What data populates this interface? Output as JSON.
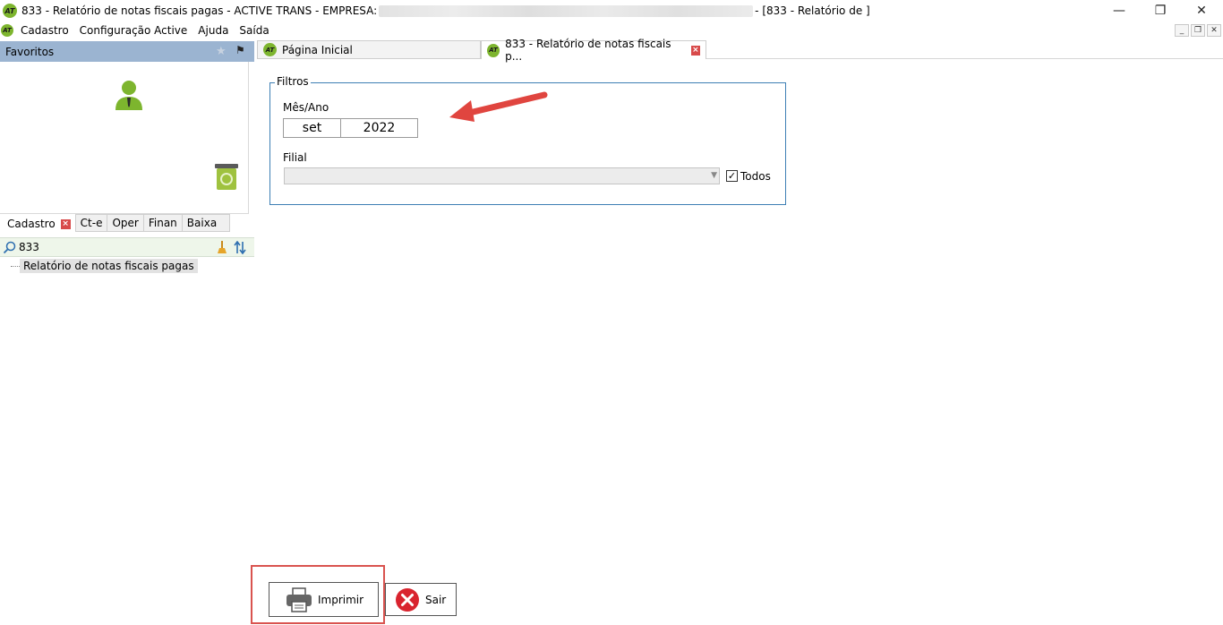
{
  "window": {
    "app_logo": "AT",
    "title_prefix": "833 - Relatório de notas fiscais pagas - ACTIVE TRANS - EMPRESA:",
    "title_suffix": "- [833 - Relatório de ]"
  },
  "menu": [
    "Cadastro",
    "Configuração Active",
    "Ajuda",
    "Saída"
  ],
  "favorites": {
    "title": "Favoritos"
  },
  "left_tabs": [
    "Cadastro",
    "Ct-e",
    "Oper",
    "Finan",
    "Baixa"
  ],
  "tree": {
    "search_value": "833",
    "item": "Relatório de notas fiscais pagas"
  },
  "doc_tabs": [
    "Página Inicial",
    "833 - Relatório de notas fiscais p..."
  ],
  "filters": {
    "legend": "Filtros",
    "mes_ano_label": "Mês/Ano",
    "month": "set",
    "year": "2022",
    "filial_label": "Filial",
    "filial_value": "",
    "todos_label": "Todos",
    "todos_checked": true
  },
  "buttons": {
    "print": "Imprimir",
    "exit": "Sair"
  },
  "colors": {
    "accent_blue": "#3d7fb4",
    "favorites_header": "#9bb4d1",
    "logo_green": "#7db52e",
    "annotation_red": "#e0453f"
  }
}
